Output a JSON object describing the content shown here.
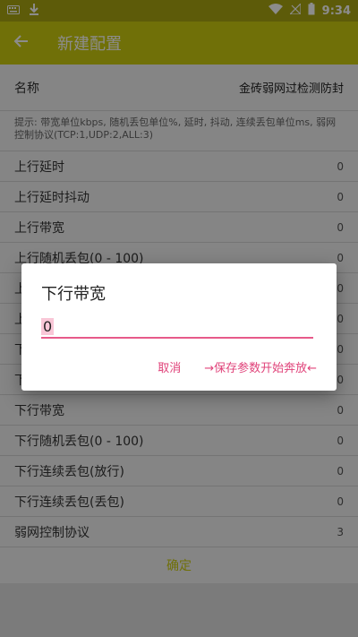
{
  "status": {
    "time": "9:34",
    "left_icons": [
      "keyboard-icon",
      "download-icon"
    ],
    "right_icons": [
      "wifi-icon",
      "signal-off-icon",
      "battery-icon"
    ]
  },
  "appbar": {
    "title": "新建配置",
    "back_icon": "arrow-left-icon"
  },
  "form": {
    "name_label": "名称",
    "name_value": "金砖弱网过检测防封",
    "hint": "提示: 带宽单位kbps, 随机丢包单位%, 延时, 抖动, 连续丢包单位ms, 弱网控制协议(TCP:1,UDP:2,ALL:3)",
    "rows": [
      {
        "label": "上行延时",
        "value": "0"
      },
      {
        "label": "上行延时抖动",
        "value": "0"
      },
      {
        "label": "上行带宽",
        "value": "0"
      },
      {
        "label": "上行随机丢包(0 - 100)",
        "value": "0"
      },
      {
        "label": "上",
        "value": "0"
      },
      {
        "label": "上",
        "value": "0"
      },
      {
        "label": "下",
        "value": "0"
      },
      {
        "label": "下",
        "value": "0"
      },
      {
        "label": "下行带宽",
        "value": "0"
      },
      {
        "label": "下行随机丢包(0 - 100)",
        "value": "0"
      },
      {
        "label": "下行连续丢包(放行)",
        "value": "0"
      },
      {
        "label": "下行连续丢包(丢包)",
        "value": "0"
      },
      {
        "label": "弱网控制协议",
        "value": "3"
      }
    ],
    "confirm_label": "确定"
  },
  "dialog": {
    "title": "下行带宽",
    "input_value": "0",
    "cancel_label": "取消",
    "save_label": "→保存参数开始奔放←"
  },
  "colors": {
    "appbar": "#cccc10",
    "statusbar": "#a9a612",
    "accent": "#e0437a"
  }
}
